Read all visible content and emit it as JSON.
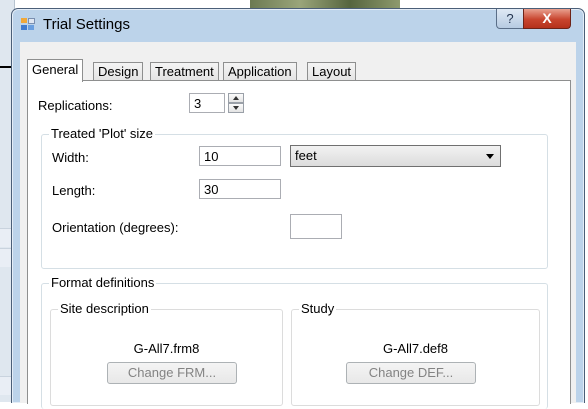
{
  "window": {
    "title": "Trial Settings",
    "help_glyph": "?",
    "close_glyph": "X"
  },
  "tabs": [
    "General",
    "Design",
    "Treatment",
    "Application",
    "Layout"
  ],
  "general": {
    "replications_label": "Replications:",
    "replications_value": "3",
    "plot_size": {
      "group_label": "Treated 'Plot' size",
      "width_label": "Width:",
      "width_value": "10",
      "unit_selected": "feet",
      "length_label": "Length:",
      "length_value": "30",
      "orientation_label": "Orientation (degrees):",
      "orientation_value": ""
    },
    "format_definitions": {
      "group_label": "Format definitions",
      "site_description": {
        "group_label": "Site description",
        "file": "G-All7.frm8",
        "button_label": "Change FRM..."
      },
      "study": {
        "group_label": "Study",
        "file": "G-All7.def8",
        "button_label": "Change DEF..."
      }
    }
  }
}
